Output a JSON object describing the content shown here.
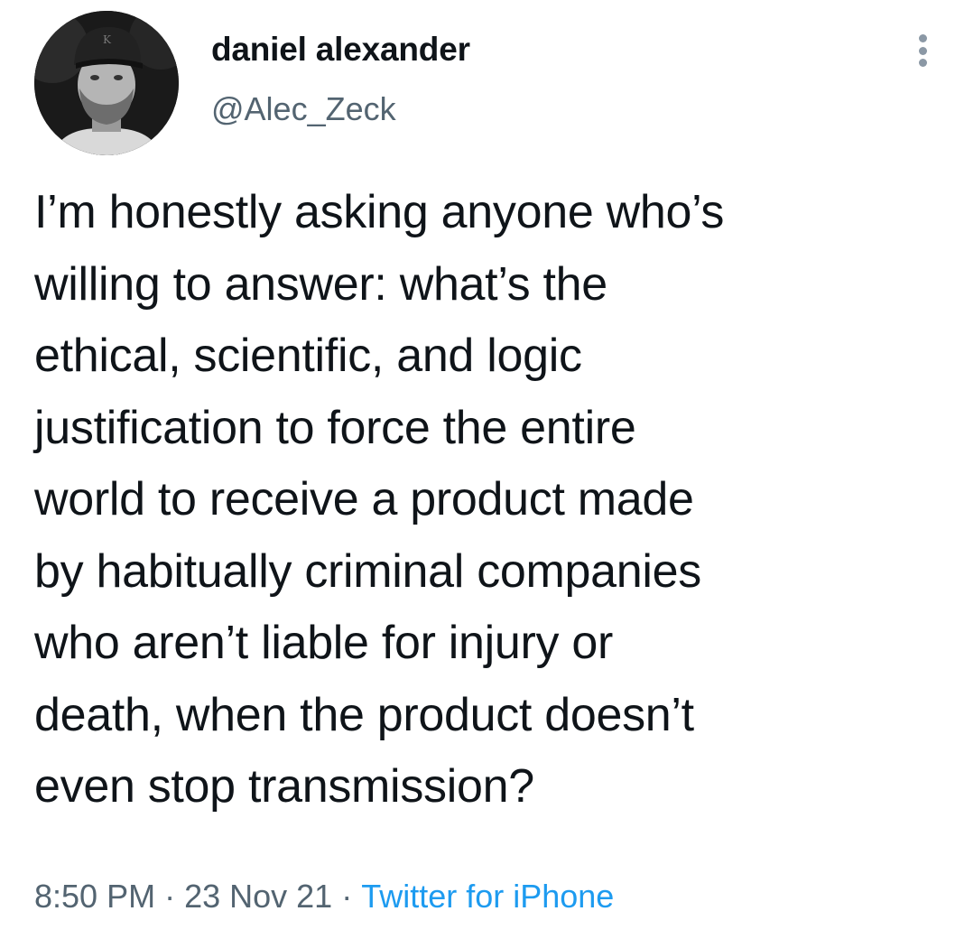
{
  "author": {
    "display_name": "daniel alexander",
    "handle": "@Alec_Zeck",
    "avatar_icon": "profile-photo-man-in-cap"
  },
  "tweet": {
    "lines": [
      "I’m honestly asking anyone who’s",
      "willing to answer: what’s the",
      "ethical, scientific, and logic",
      "justification to force the entire",
      "world to receive a product made",
      "by habitually criminal companies",
      "who aren’t liable for injury or",
      "death, when the product doesn’t",
      "even stop transmission?"
    ]
  },
  "meta": {
    "time": "8:50 PM",
    "separator": "·",
    "date": "23 Nov 21",
    "source": "Twitter for iPhone"
  },
  "colors": {
    "text": "#0f1419",
    "secondary": "#536471",
    "link": "#1d9bf0"
  }
}
